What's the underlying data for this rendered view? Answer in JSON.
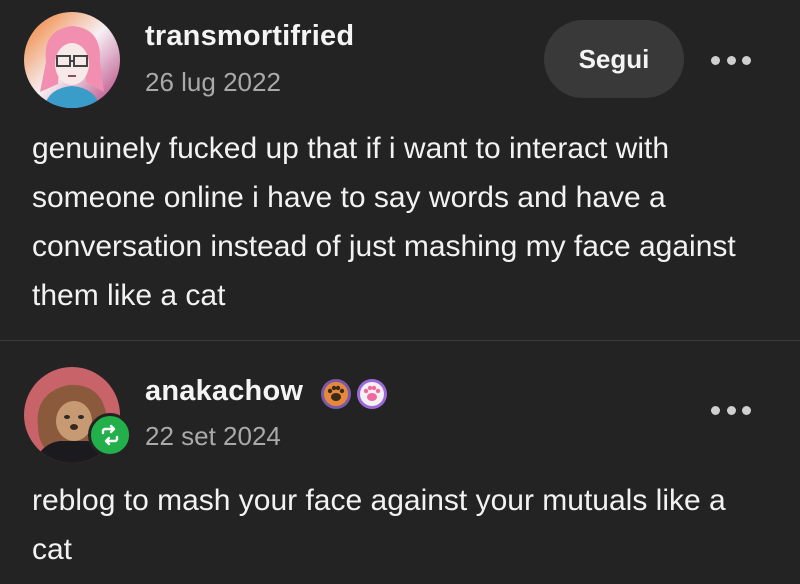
{
  "posts": [
    {
      "username": "transmortifried",
      "date": "26 lug 2022",
      "follow_label": "Segui",
      "text": "genuinely fucked up that if i want to interact with someone online i have to say words and have a conversation instead of just mashing my face against them like a cat"
    },
    {
      "username": "anakachow",
      "date": "22 set 2024",
      "text": "reblog to mash your face against your mutuals like a cat",
      "badges": [
        "paw-badge-orange-icon",
        "paw-badge-pink-icon"
      ]
    }
  ],
  "colors": {
    "background": "#232323",
    "reblog_green": "#23b04b",
    "follow_button_bg": "#393939",
    "date_text": "#a9a9a9"
  }
}
